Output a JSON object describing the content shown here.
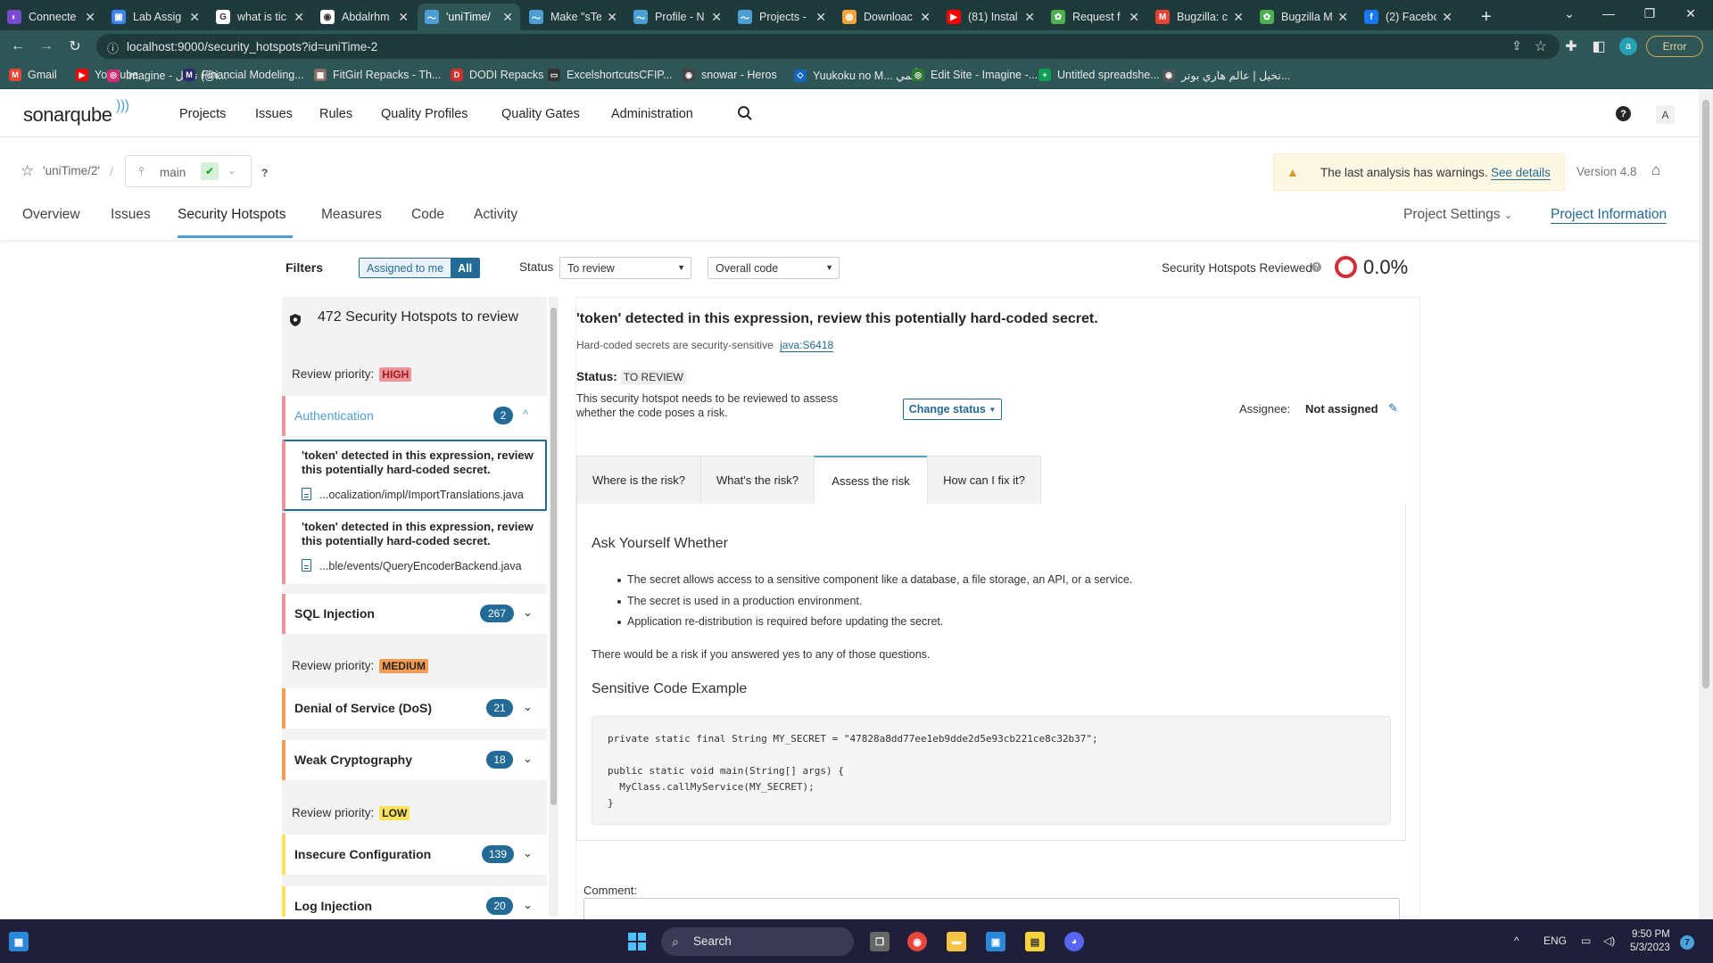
{
  "browser": {
    "tabs": [
      {
        "title": "Connecte",
        "color": "#7a4bd1",
        "glyph": "◐"
      },
      {
        "title": "Lab Assig",
        "color": "#3b82f6",
        "glyph": "▣"
      },
      {
        "title": "what is tic",
        "color": "#ffffff",
        "glyph": "G"
      },
      {
        "title": "Abdalrhm",
        "color": "#ffffff",
        "glyph": "◉"
      },
      {
        "title": "'uniTime/",
        "color": "#4b9fd5",
        "glyph": "〜"
      },
      {
        "title": "Make \"sTe",
        "color": "#4b9fd5",
        "glyph": "〜"
      },
      {
        "title": "Profile - N",
        "color": "#4b9fd5",
        "glyph": "〜"
      },
      {
        "title": "Projects - ",
        "color": "#4b9fd5",
        "glyph": "〜"
      },
      {
        "title": "Downloac",
        "color": "#f2a33a",
        "glyph": "◍"
      },
      {
        "title": "(81) Instal",
        "color": "#ff0000",
        "glyph": "▶"
      },
      {
        "title": "Request f",
        "color": "#4caf50",
        "glyph": "✿"
      },
      {
        "title": "Bugzilla: c",
        "color": "#ea4335",
        "glyph": "M"
      },
      {
        "title": "Bugzilla M",
        "color": "#4caf50",
        "glyph": "✿"
      },
      {
        "title": "(2) Facebo",
        "color": "#1877f2",
        "glyph": "f"
      }
    ],
    "url": "localhost:9000/security_hotspots?id=uniTime-2",
    "profile_initial": "a",
    "error_label": "Error",
    "bookmarks": [
      {
        "label": "Gmail",
        "color": "#ea4335",
        "glyph": "M"
      },
      {
        "label": "YouTube",
        "color": "#ff0000",
        "glyph": "▶"
      },
      {
        "label": "Imagine - تخيل (@i...",
        "color": "#d62976",
        "glyph": "◎"
      },
      {
        "label": "Financial Modeling...",
        "color": "#2b2b6b",
        "glyph": "M"
      },
      {
        "label": "FitGirl Repacks - Th...",
        "color": "#8d6e63",
        "glyph": "▦"
      },
      {
        "label": "DODI Repacks",
        "color": "#d32f2f",
        "glyph": "D"
      },
      {
        "label": "ExcelshortcutsCFIP...",
        "color": "#333333",
        "glyph": "▭"
      },
      {
        "label": "snowar - Heros",
        "color": "#444444",
        "glyph": "◉"
      },
      {
        "label": "Yuukoku no M... أنمي",
        "color": "#1565c0",
        "glyph": "◇"
      },
      {
        "label": "Edit Site - Imagine -...",
        "color": "#2e7d32",
        "glyph": "◎"
      },
      {
        "label": "Untitled spreadshe...",
        "color": "#0f9d58",
        "glyph": "+"
      },
      {
        "label": "تخيل | عالم هاري بوتر...",
        "color": "#555555",
        "glyph": "◉"
      }
    ]
  },
  "sonar": {
    "logo": "sonarqube",
    "nav": [
      "Projects",
      "Issues",
      "Rules",
      "Quality Profiles",
      "Quality Gates",
      "Administration"
    ],
    "user_initial": "A",
    "project": {
      "name": "'uniTime/2'",
      "branch": "main",
      "warning_text": "The last analysis has warnings.",
      "warning_link": "See details",
      "version": "Version 4.8",
      "tabs": [
        "Overview",
        "Issues",
        "Security Hotspots",
        "Measures",
        "Code",
        "Activity"
      ],
      "settings": "Project Settings",
      "info": "Project Information"
    },
    "filters": {
      "label": "Filters",
      "assigned": "Assigned to me",
      "all": "All",
      "status_label": "Status",
      "status_value": "To review",
      "scope_value": "Overall code",
      "reviewed_label": "Security Hotspots Reviewed",
      "reviewed_pct": "0.0%"
    },
    "list": {
      "title": "472 Security Hotspots to review",
      "prio_label": "Review priority:",
      "priorities": {
        "high": "HIGH",
        "medium": "MEDIUM",
        "low": "LOW"
      },
      "categories": [
        {
          "name": "Authentication",
          "count": "2"
        },
        {
          "name": "SQL Injection",
          "count": "267"
        },
        {
          "name": "Denial of Service (DoS)",
          "count": "21"
        },
        {
          "name": "Weak Cryptography",
          "count": "18"
        },
        {
          "name": "Insecure Configuration",
          "count": "139"
        },
        {
          "name": "Log Injection",
          "count": "20"
        }
      ],
      "hotspots": [
        {
          "title": "'token' detected in this expression, review this potentially hard-coded secret.",
          "file": "...ocalization/impl/ImportTranslations.java"
        },
        {
          "title": "'token' detected in this expression, review this potentially hard-coded secret.",
          "file": "...ble/events/QueryEncoderBackend.java"
        }
      ]
    },
    "detail": {
      "title": "'token' detected in this expression, review this potentially hard-coded secret.",
      "subtitle": "Hard-coded secrets are security-sensitive",
      "rule": "java:S6418",
      "status_label": "Status:",
      "status_value": "TO REVIEW",
      "status_desc": "This security hotspot needs to be reviewed to assess whether the code poses a risk.",
      "change_status": "Change status",
      "assignee_label": "Assignee:",
      "assignee_value": "Not assigned",
      "tabs": [
        "Where is the risk?",
        "What's the risk?",
        "Assess the risk",
        "How can I fix it?"
      ],
      "ask_heading": "Ask Yourself Whether",
      "bullets": [
        "The secret allows access to a sensitive component like a database, a file storage, an API, or a service.",
        "The secret is used in a production environment.",
        "Application re-distribution is required before updating the secret."
      ],
      "risk_line": "There would be a risk if you answered yes to any of those questions.",
      "example_heading": "Sensitive Code Example",
      "code": [
        "private static final String MY_SECRET = \"47828a8dd77ee1eb9dde2d5e93cb221ce8c32b37\";",
        "",
        "public static void main(String[] args) {",
        "  MyClass.callMyService(MY_SECRET);",
        "}"
      ],
      "comment_label": "Comment:"
    }
  },
  "taskbar": {
    "search": "Search",
    "lang": "ENG",
    "time": "9:50 PM",
    "date": "5/3/2023",
    "notifications": "7"
  }
}
